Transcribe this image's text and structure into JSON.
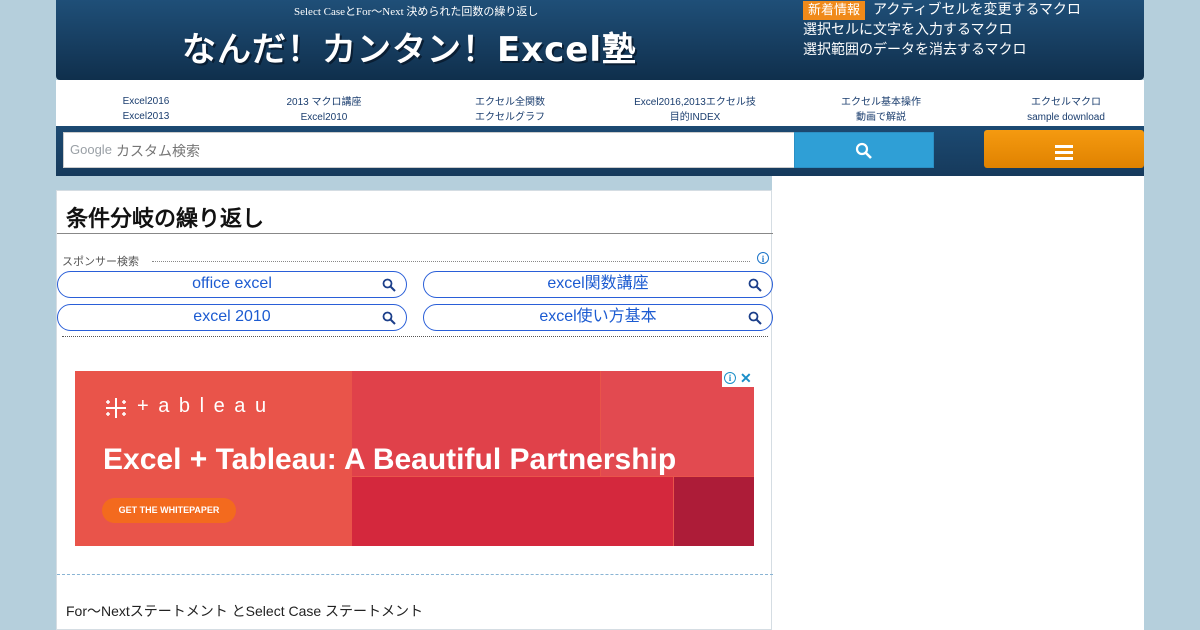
{
  "header": {
    "subtitle": "Select CaseとFor～Next 決められた回数の繰り返し",
    "site_title": "なんだ！カンタン！Excel塾",
    "news_badge": "新着情報",
    "news": [
      "アクティブセルを変更するマクロ",
      "選択セルに文字を入力するマクロ",
      "選択範囲のデータを消去するマクロ"
    ]
  },
  "nav": {
    "items": [
      {
        "line1": "Excel2016",
        "line2": "Excel2013"
      },
      {
        "line1": "2013 マクロ講座",
        "line2": "Excel2010"
      },
      {
        "line1": "エクセル全関数",
        "line2": "エクセルグラフ"
      },
      {
        "line1": "Excel2016,2013エクセル技",
        "line2": "目的INDEX"
      },
      {
        "line1": "エクセル基本操作",
        "line2": "動画で解説"
      },
      {
        "line1": "エクセルマクロ",
        "line2": "sample download"
      }
    ]
  },
  "search": {
    "brand": "Google",
    "placeholder": "カスタム検索"
  },
  "main": {
    "title": "条件分岐の繰り返し",
    "sponsor_label": "スポンサー検索",
    "sponsor_links": [
      "office excel",
      "excel関数講座",
      "excel 2010",
      "excel使い方基本"
    ],
    "body_text": "For～Nextステートメント とSelect Case ステートメント"
  },
  "ad": {
    "brand": "+ a b l e a u",
    "headline": "Excel + Tableau: A Beautiful Partnership",
    "cta": "GET THE WHITEPAPER"
  },
  "colors": {
    "header": "#163c5e",
    "accent_orange": "#f08a1a",
    "link_blue": "#1c5bd1",
    "ad_red": "#e9544a"
  }
}
